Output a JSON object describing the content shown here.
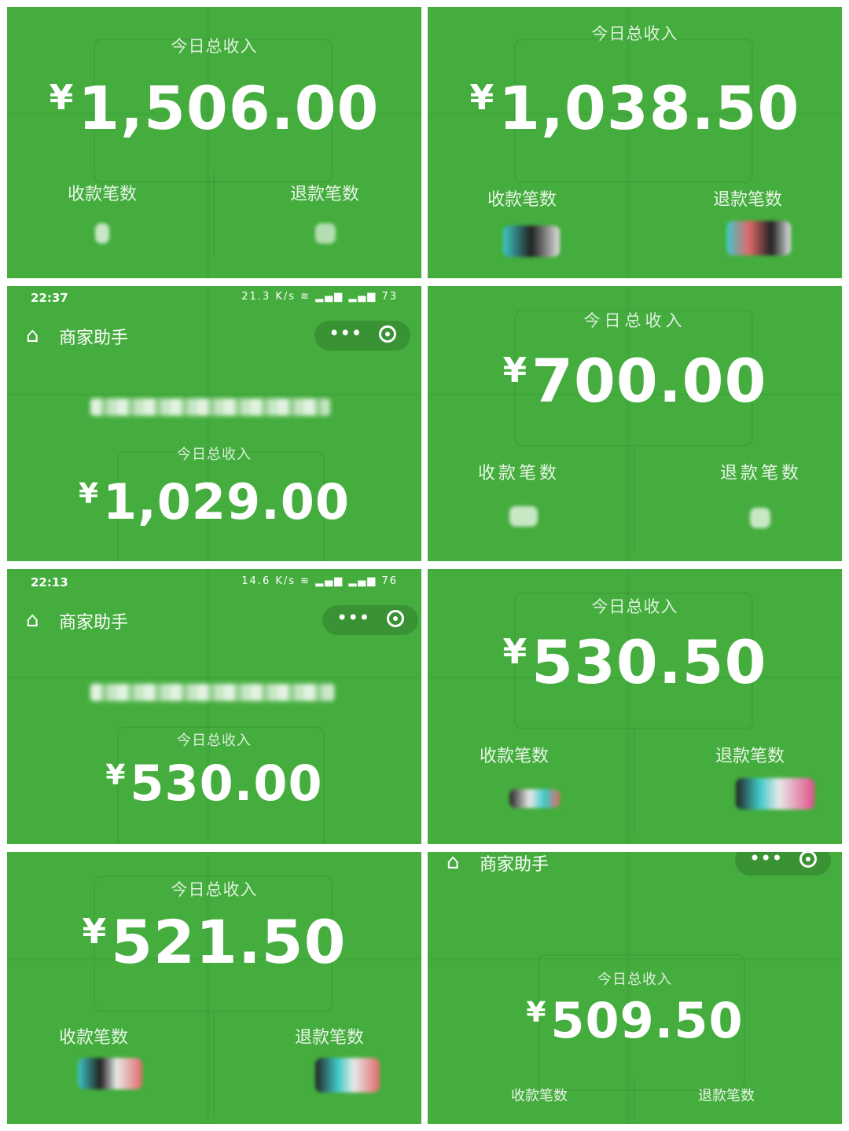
{
  "panels": [
    {
      "title": "今日总收入",
      "currency": "¥",
      "amount": "1,506.00",
      "count_label": "收款笔数",
      "refund_label": "退款笔数"
    },
    {
      "title": "今日总收入",
      "currency": "¥",
      "amount": "1,038.50",
      "count_label": "收款笔数",
      "refund_label": "退款笔数"
    },
    {
      "time": "22:37",
      "net": "21.3 K/s",
      "battery": "73",
      "nav_title": "商家助手",
      "title": "今日总收入",
      "currency": "¥",
      "amount": "1,029.00"
    },
    {
      "title": "今日总收入",
      "currency": "¥",
      "amount": "700.00",
      "count_label": "收款笔数",
      "refund_label": "退款笔数"
    },
    {
      "time": "22:13",
      "net": "14.6 K/s",
      "battery": "76",
      "nav_title": "商家助手",
      "title": "今日总收入",
      "currency": "¥",
      "amount": "530.00"
    },
    {
      "title": "今日总收入",
      "currency": "¥",
      "amount": "530.50",
      "count_label": "收款笔数",
      "refund_label": "退款笔数"
    },
    {
      "title": "今日总收入",
      "currency": "¥",
      "amount": "521.50",
      "count_label": "收款笔数",
      "refund_label": "退款笔数"
    },
    {
      "nav_title": "商家助手",
      "title": "今日总收入",
      "currency": "¥",
      "amount": "509.50",
      "count_label": "收款笔数",
      "refund_label": "退款笔数"
    }
  ],
  "icons": {
    "home": "home-icon",
    "more": "more-dots-icon",
    "close": "target-close-icon"
  },
  "colors": {
    "panel_green": "#44ad3e"
  }
}
